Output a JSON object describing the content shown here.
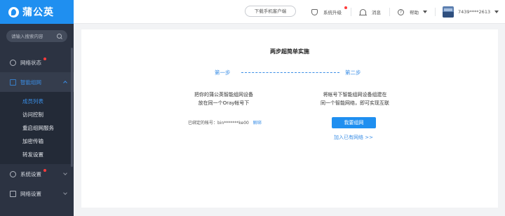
{
  "app": {
    "logo_text": "蒲公英"
  },
  "sidebar": {
    "search_placeholder": "请输入搜索内容",
    "items": [
      {
        "label": "网络状态"
      },
      {
        "label": "智能组网"
      },
      {
        "label": "系统设置"
      },
      {
        "label": "网络设置"
      }
    ],
    "subitems": [
      "成员列表",
      "访问控制",
      "重启组网服务",
      "加密传输",
      "转发设置"
    ]
  },
  "topbar": {
    "download_label": "下载手机客户端",
    "upgrade_label": "系统升级",
    "message_label": "消息",
    "help_label": "帮助",
    "help_icon_glyph": "?",
    "account_label": "7439****2613"
  },
  "main": {
    "title": "两步超简单实施",
    "step1_label": "第一步",
    "step2_label": "第二步",
    "step1_desc_line1": "把你的蒲公英智能组网设备",
    "step1_desc_line2": "放在同一个Oray帐号下",
    "step2_desc_line1": "将帐号下智能组网设备组建在",
    "step2_desc_line2": "同一个智能网络，即可实现互联",
    "bound_label": "已绑定的帐号：bin*******ke00",
    "unbind_label": "解绑",
    "primary_button": "我要组网",
    "join_link": "加入已有网络 >>"
  },
  "colors": {
    "accent": "#1f8ff0",
    "sidebar_bg": "#2c3342",
    "alert": "#ff3b3b"
  }
}
